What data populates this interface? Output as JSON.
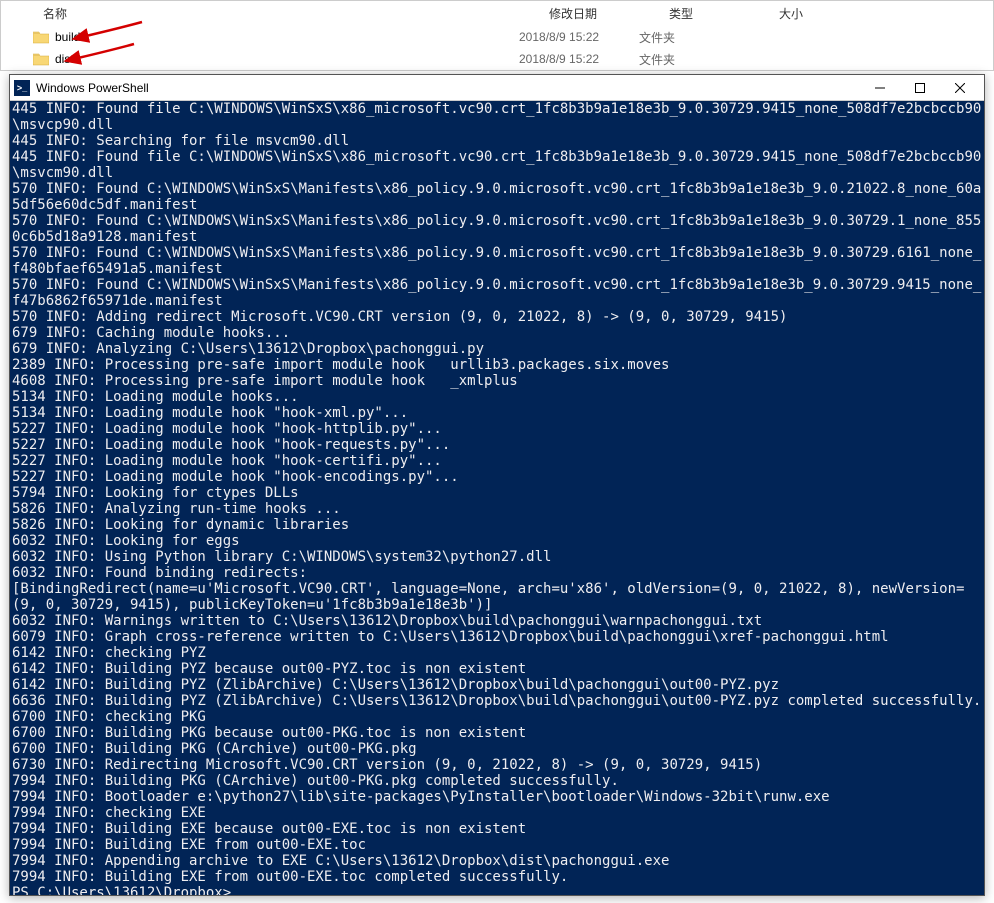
{
  "explorer": {
    "headers": {
      "name": "名称",
      "date": "修改日期",
      "type": "类型",
      "size": "大小"
    },
    "rows": [
      {
        "name": "build",
        "date": "2018/8/9 15:22",
        "type": "文件夹",
        "size": ""
      },
      {
        "name": "dist",
        "date": "2018/8/9 15:22",
        "type": "文件夹",
        "size": ""
      }
    ]
  },
  "ps": {
    "title": "Windows PowerShell",
    "prompt": "PS C:\\Users\\13612\\Dropbox>",
    "lines": [
      "445 INFO: Found file C:\\WINDOWS\\WinSxS\\x86_microsoft.vc90.crt_1fc8b3b9a1e18e3b_9.0.30729.9415_none_508df7e2bcbccb90\\msvcp90.dll",
      "445 INFO: Searching for file msvcm90.dll",
      "445 INFO: Found file C:\\WINDOWS\\WinSxS\\x86_microsoft.vc90.crt_1fc8b3b9a1e18e3b_9.0.30729.9415_none_508df7e2bcbccb90\\msvcm90.dll",
      "570 INFO: Found C:\\WINDOWS\\WinSxS\\Manifests\\x86_policy.9.0.microsoft.vc90.crt_1fc8b3b9a1e18e3b_9.0.21022.8_none_60a5df56e60dc5df.manifest",
      "570 INFO: Found C:\\WINDOWS\\WinSxS\\Manifests\\x86_policy.9.0.microsoft.vc90.crt_1fc8b3b9a1e18e3b_9.0.30729.1_none_8550c6b5d18a9128.manifest",
      "570 INFO: Found C:\\WINDOWS\\WinSxS\\Manifests\\x86_policy.9.0.microsoft.vc90.crt_1fc8b3b9a1e18e3b_9.0.30729.6161_none_f480bfaef65491a5.manifest",
      "570 INFO: Found C:\\WINDOWS\\WinSxS\\Manifests\\x86_policy.9.0.microsoft.vc90.crt_1fc8b3b9a1e18e3b_9.0.30729.9415_none_f47b6862f65971de.manifest",
      "570 INFO: Adding redirect Microsoft.VC90.CRT version (9, 0, 21022, 8) -> (9, 0, 30729, 9415)",
      "679 INFO: Caching module hooks...",
      "679 INFO: Analyzing C:\\Users\\13612\\Dropbox\\pachonggui.py",
      "2389 INFO: Processing pre-safe import module hook   urllib3.packages.six.moves",
      "4608 INFO: Processing pre-safe import module hook   _xmlplus",
      "5134 INFO: Loading module hooks...",
      "5134 INFO: Loading module hook \"hook-xml.py\"...",
      "5227 INFO: Loading module hook \"hook-httplib.py\"...",
      "5227 INFO: Loading module hook \"hook-requests.py\"...",
      "5227 INFO: Loading module hook \"hook-certifi.py\"...",
      "5227 INFO: Loading module hook \"hook-encodings.py\"...",
      "5794 INFO: Looking for ctypes DLLs",
      "5826 INFO: Analyzing run-time hooks ...",
      "5826 INFO: Looking for dynamic libraries",
      "6032 INFO: Looking for eggs",
      "6032 INFO: Using Python library C:\\WINDOWS\\system32\\python27.dll",
      "6032 INFO: Found binding redirects:",
      "[BindingRedirect(name=u'Microsoft.VC90.CRT', language=None, arch=u'x86', oldVersion=(9, 0, 21022, 8), newVersion=(9, 0, 30729, 9415), publicKeyToken=u'1fc8b3b9a1e18e3b')]",
      "6032 INFO: Warnings written to C:\\Users\\13612\\Dropbox\\build\\pachonggui\\warnpachonggui.txt",
      "6079 INFO: Graph cross-reference written to C:\\Users\\13612\\Dropbox\\build\\pachonggui\\xref-pachonggui.html",
      "6142 INFO: checking PYZ",
      "6142 INFO: Building PYZ because out00-PYZ.toc is non existent",
      "6142 INFO: Building PYZ (ZlibArchive) C:\\Users\\13612\\Dropbox\\build\\pachonggui\\out00-PYZ.pyz",
      "6636 INFO: Building PYZ (ZlibArchive) C:\\Users\\13612\\Dropbox\\build\\pachonggui\\out00-PYZ.pyz completed successfully.",
      "6700 INFO: checking PKG",
      "6700 INFO: Building PKG because out00-PKG.toc is non existent",
      "6700 INFO: Building PKG (CArchive) out00-PKG.pkg",
      "6730 INFO: Redirecting Microsoft.VC90.CRT version (9, 0, 21022, 8) -> (9, 0, 30729, 9415)",
      "7994 INFO: Building PKG (CArchive) out00-PKG.pkg completed successfully.",
      "7994 INFO: Bootloader e:\\python27\\lib\\site-packages\\PyInstaller\\bootloader\\Windows-32bit\\runw.exe",
      "7994 INFO: checking EXE",
      "7994 INFO: Building EXE because out00-EXE.toc is non existent",
      "7994 INFO: Building EXE from out00-EXE.toc",
      "7994 INFO: Appending archive to EXE C:\\Users\\13612\\Dropbox\\dist\\pachonggui.exe",
      "7994 INFO: Building EXE from out00-EXE.toc completed successfully."
    ]
  }
}
